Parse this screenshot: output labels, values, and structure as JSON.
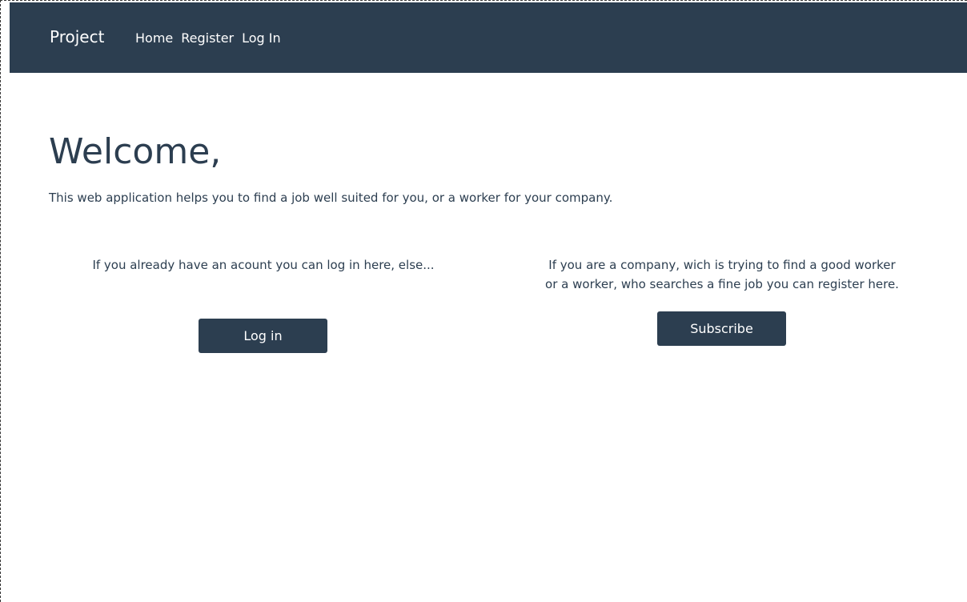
{
  "navbar": {
    "brand": "Project",
    "links": [
      "Home",
      "Register",
      "Log In"
    ]
  },
  "hero": {
    "title": "Welcome,",
    "intro": "This web application helps you to find a job well suited for you, or a worker for your company."
  },
  "login_section": {
    "text": "If you already have an acount you can log in here, else...",
    "button_label": "Log in"
  },
  "register_section": {
    "text_line1": "If you are a company, wich is trying to find a good worker",
    "text_line2": "or a worker, who searches a fine job you can register here.",
    "button_label": "Subscribe"
  },
  "colors": {
    "primary": "#2c3e50",
    "background": "#ffffff"
  }
}
